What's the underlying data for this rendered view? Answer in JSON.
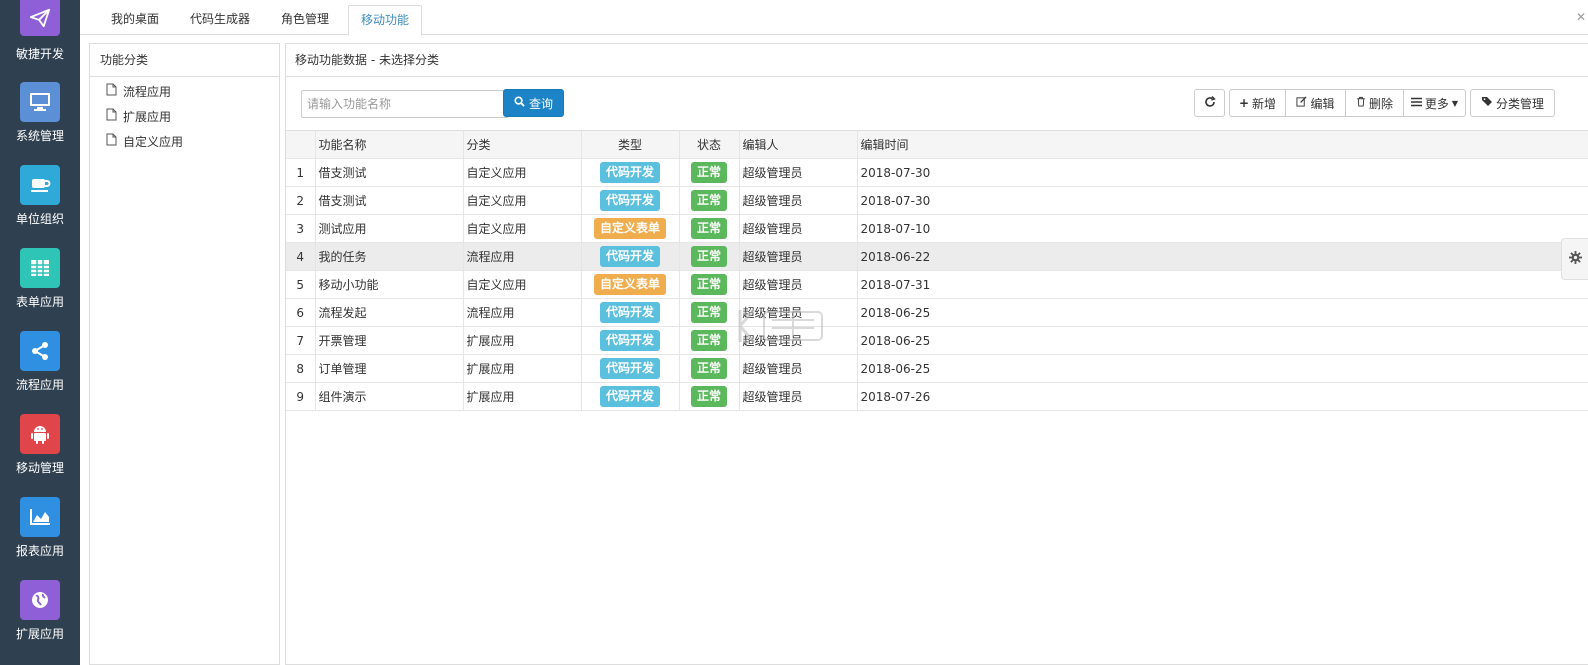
{
  "sidebar": {
    "items": [
      {
        "label": "敏捷开发",
        "icon": "paper-plane-icon",
        "color": "#8e5fd6"
      },
      {
        "label": "系统管理",
        "icon": "monitor-icon",
        "color": "#5b8fd6"
      },
      {
        "label": "单位组织",
        "icon": "coffee-cup-icon",
        "color": "#2fa9d8"
      },
      {
        "label": "表单应用",
        "icon": "table-icon",
        "color": "#2ec4b6"
      },
      {
        "label": "流程应用",
        "icon": "share-icon",
        "color": "#2f8fe0"
      },
      {
        "label": "移动管理",
        "icon": "android-icon",
        "color": "#e0454a"
      },
      {
        "label": "报表应用",
        "icon": "area-chart-icon",
        "color": "#2f8fe0"
      },
      {
        "label": "扩展应用",
        "icon": "globe-icon",
        "color": "#8e5fd6"
      }
    ]
  },
  "tabs": [
    {
      "label": "我的桌面"
    },
    {
      "label": "代码生成器"
    },
    {
      "label": "角色管理"
    },
    {
      "label": "移动功能"
    }
  ],
  "category_panel": {
    "title": "功能分类",
    "items": [
      {
        "label": "流程应用"
      },
      {
        "label": "扩展应用"
      },
      {
        "label": "自定义应用"
      }
    ]
  },
  "main": {
    "title": "移动功能数据 - 未选择分类",
    "search": {
      "placeholder": "请输入功能名称",
      "value": ""
    },
    "query_label": "查询",
    "toolbar": {
      "add": "新增",
      "edit": "编辑",
      "delete": "删除",
      "more": "更多",
      "category_manage": "分类管理"
    },
    "columns": [
      "功能名称",
      "分类",
      "类型",
      "状态",
      "编辑人",
      "编辑时间"
    ],
    "rows": [
      {
        "no": "1",
        "name": "借支测试",
        "category": "自定义应用",
        "type": "代码开发",
        "status": "正常",
        "editor": "超级管理员",
        "time": "2018-07-30"
      },
      {
        "no": "2",
        "name": "借支测试",
        "category": "自定义应用",
        "type": "代码开发",
        "status": "正常",
        "editor": "超级管理员",
        "time": "2018-07-30"
      },
      {
        "no": "3",
        "name": "测试应用",
        "category": "自定义应用",
        "type": "自定义表单",
        "status": "正常",
        "editor": "超级管理员",
        "time": "2018-07-10"
      },
      {
        "no": "4",
        "name": "我的任务",
        "category": "流程应用",
        "type": "代码开发",
        "status": "正常",
        "editor": "超级管理员",
        "time": "2018-06-22"
      },
      {
        "no": "5",
        "name": "移动小功能",
        "category": "自定义应用",
        "type": "自定义表单",
        "status": "正常",
        "editor": "超级管理员",
        "time": "2018-07-31"
      },
      {
        "no": "6",
        "name": "流程发起",
        "category": "流程应用",
        "type": "代码开发",
        "status": "正常",
        "editor": "超级管理员",
        "time": "2018-06-25"
      },
      {
        "no": "7",
        "name": "开票管理",
        "category": "扩展应用",
        "type": "代码开发",
        "status": "正常",
        "editor": "超级管理员",
        "time": "2018-06-25"
      },
      {
        "no": "8",
        "name": "订单管理",
        "category": "扩展应用",
        "type": "代码开发",
        "status": "正常",
        "editor": "超级管理员",
        "time": "2018-06-25"
      },
      {
        "no": "9",
        "name": "组件演示",
        "category": "扩展应用",
        "type": "代码开发",
        "status": "正常",
        "editor": "超级管理员",
        "time": "2018-07-26"
      }
    ]
  },
  "colors": {
    "primary": "#1c84c6",
    "badge_code": "#5bc0de",
    "badge_form": "#f0ad4e",
    "badge_ok": "#5cb85c",
    "sidebar_bg": "#2f4050"
  }
}
